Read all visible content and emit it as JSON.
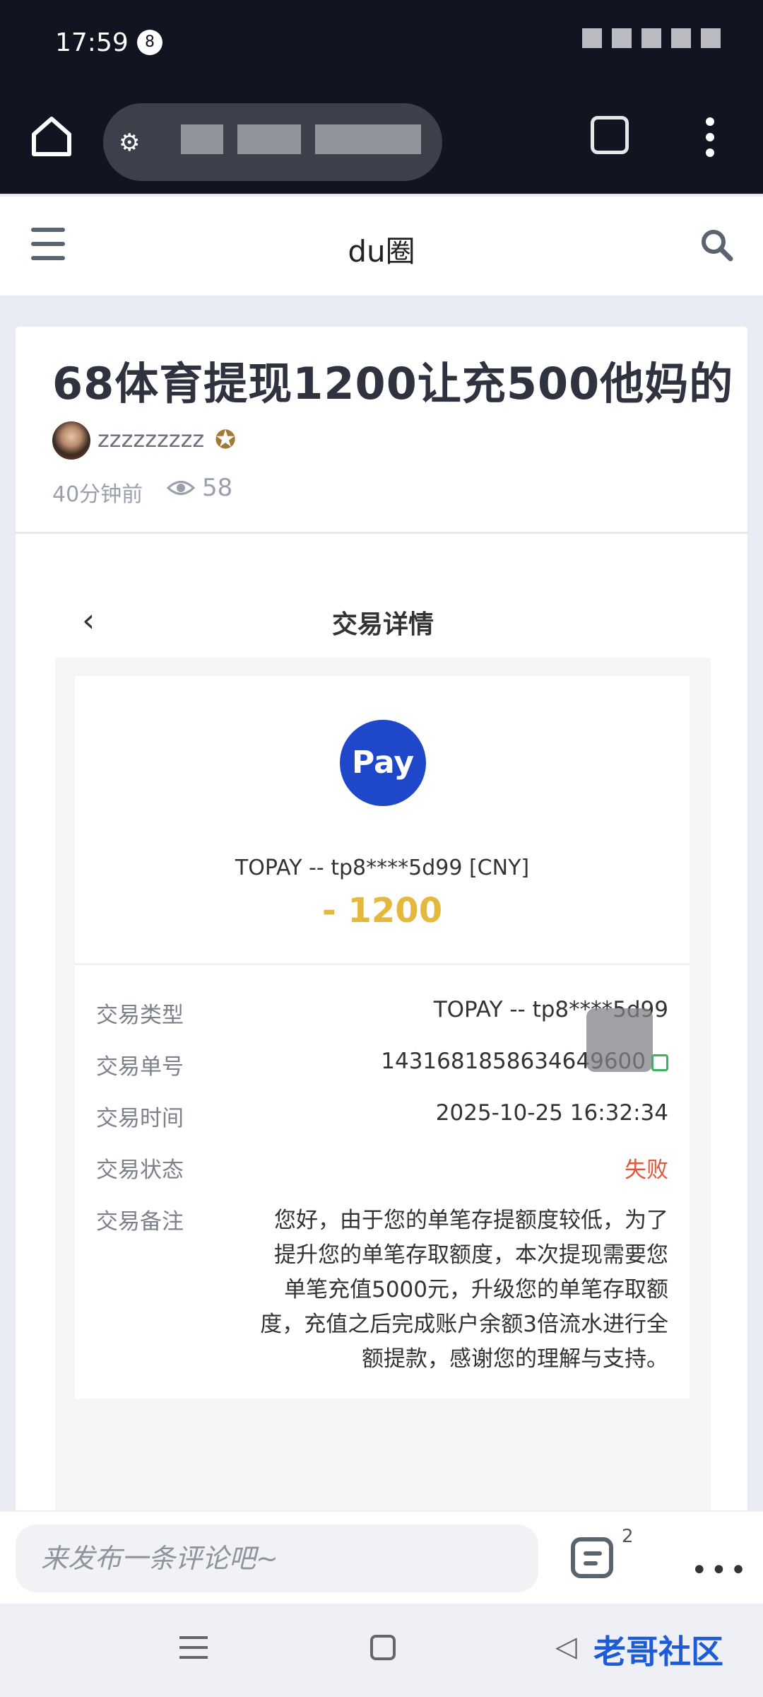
{
  "status": {
    "time": "17:59",
    "notif_count": "8"
  },
  "appbar": {
    "title": "du圈"
  },
  "post": {
    "title": "68体育提现1200让充500他妈的",
    "author": "zzzzzzzzz",
    "time": "40分钟前",
    "views": "58"
  },
  "detail": {
    "header": "交易详情",
    "pay_label": "Pay",
    "merchant": "TOPAY -- tp8****5d99 [CNY]",
    "amount": "- 1200",
    "rows": [
      {
        "key": "交易类型",
        "value": "TOPAY -- tp8****5d99"
      },
      {
        "key": "交易单号",
        "value": "14316818586346496​00"
      },
      {
        "key": "交易时间",
        "value": "2025-10-25 16:32:34"
      },
      {
        "key": "交易状态",
        "value": "失败"
      }
    ],
    "remark_key": "交易备注",
    "remark_lines": [
      "您好，由于您的单笔存提额度较低，为了",
      "提升您的单笔存取额度，本次提现需要您",
      "单笔充值5000元，升级您的单笔存取额",
      "度，充值之后完成账户余额3倍流水进行全",
      "额提款，感谢您的理解与支持。"
    ]
  },
  "comment": {
    "placeholder": "来发布一条评论吧~",
    "count": "2"
  },
  "watermark": "老哥社区",
  "colors": {
    "accent_pay": "#1f47c9",
    "amount": "#e4b83d",
    "fail": "#e0563a"
  }
}
